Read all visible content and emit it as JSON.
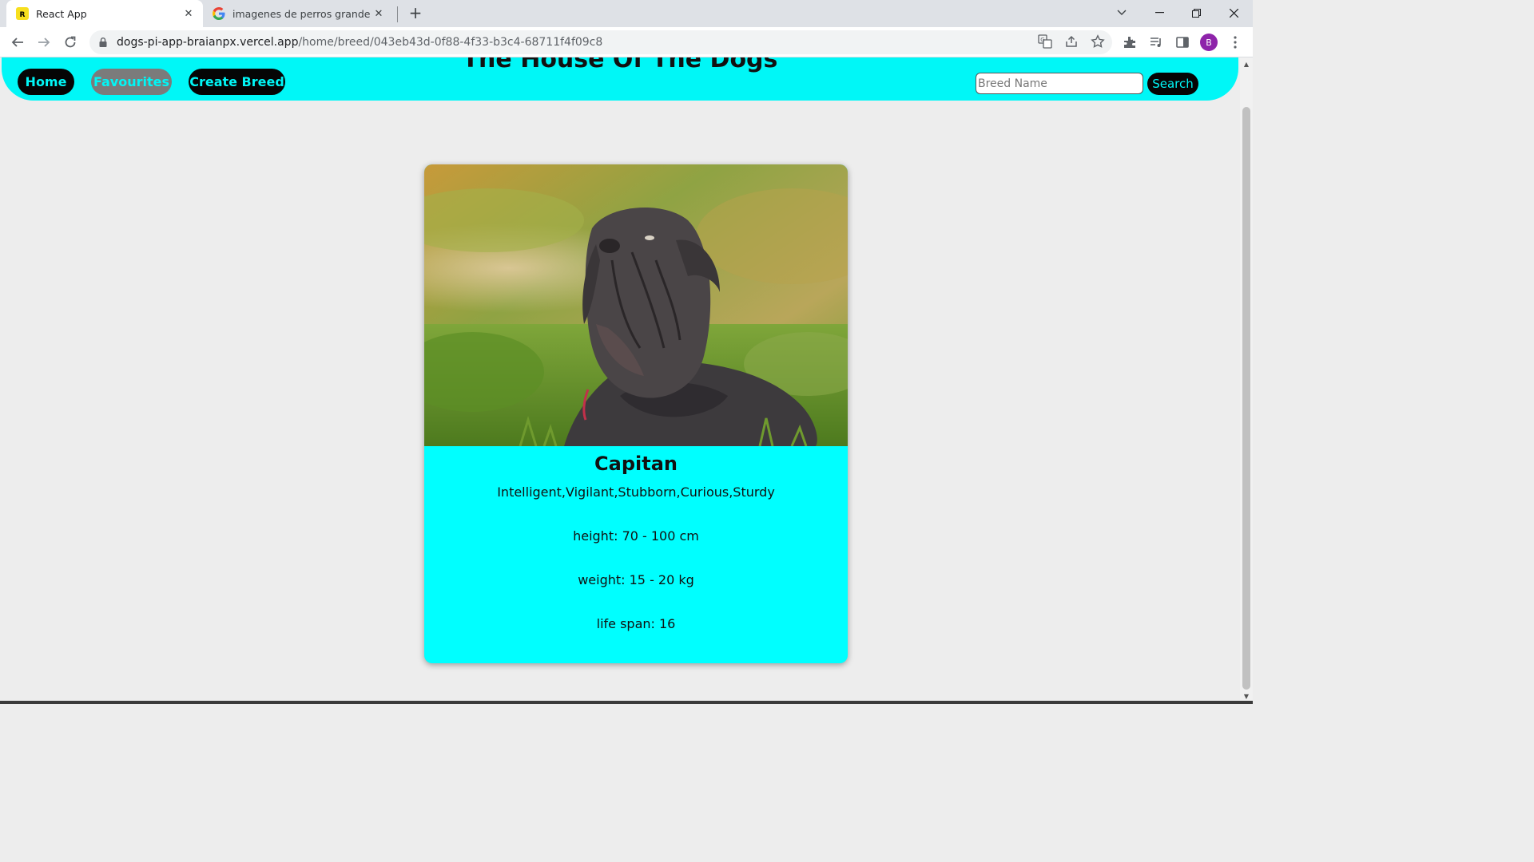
{
  "browser": {
    "tabs": [
      {
        "title": "React App",
        "active": true
      },
      {
        "title": "imagenes de perros grandes - Bu",
        "active": false
      }
    ],
    "url_domain": "dogs-pi-app-braianpx.vercel.app",
    "url_path": "/home/breed/043eb43d-0f88-4f33-b3c4-68711f4f09c8",
    "profile_initial": "B"
  },
  "header": {
    "title": "The House Of The Dogs",
    "nav": {
      "home": "Home",
      "favourites": "Favourites",
      "create_breed": "Create Breed"
    },
    "search": {
      "placeholder": "Breed Name",
      "button": "Search"
    }
  },
  "breed": {
    "name": "Capitan",
    "temperament": "Intelligent,Vigilant,Stubborn,Curious,Sturdy",
    "height": "height: 70 - 100 cm",
    "weight": "weight: 15 - 20 kg",
    "life_span": "life span: 16"
  },
  "colors": {
    "accent": "#00f7f7",
    "card_body": "#00ffff",
    "button_dark": "#050505",
    "button_grey": "#7b7b7b",
    "page_bg": "#ededed"
  }
}
